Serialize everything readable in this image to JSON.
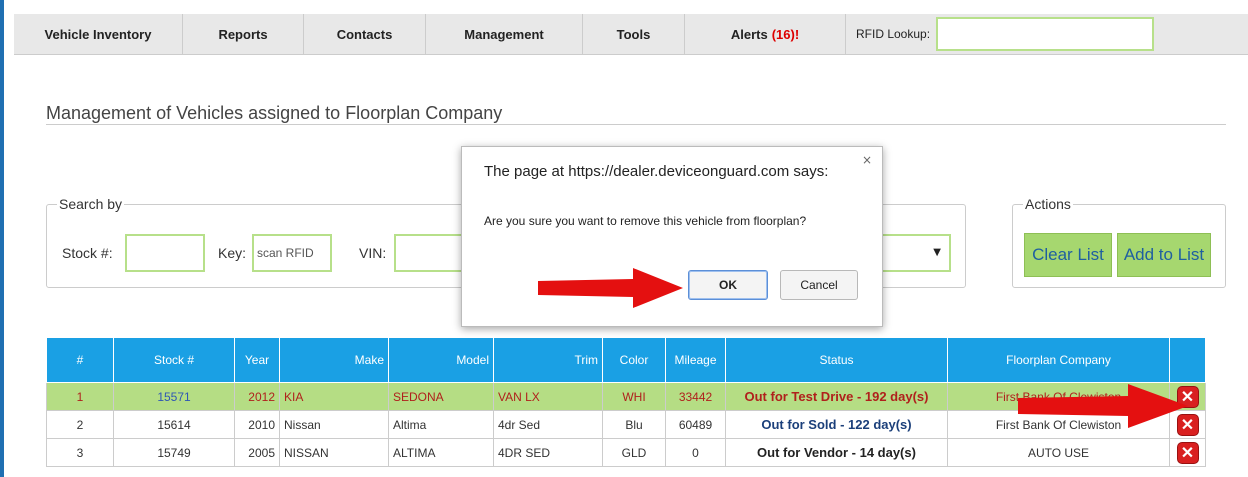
{
  "nav": {
    "items": [
      "Vehicle Inventory",
      "Reports",
      "Contacts",
      "Management",
      "Tools"
    ],
    "alerts_label": "Alerts",
    "alerts_count": "(16)!",
    "rfid_label": "RFID Lookup:",
    "rfid_value": ""
  },
  "page": {
    "title": "Management of Vehicles assigned to Floorplan Company"
  },
  "search": {
    "legend": "Search by",
    "stock_label": "Stock #:",
    "key_label": "Key:",
    "key_value": "scan RFID",
    "vin_label": "VIN:"
  },
  "actions": {
    "legend": "Actions",
    "clear_label": "Clear List",
    "add_label": "Add to List"
  },
  "table": {
    "headers": [
      "#",
      "Stock #",
      "Year",
      "Make",
      "Model",
      "Trim",
      "Color",
      "Mileage",
      "Status",
      "Floorplan Company",
      ""
    ],
    "rows": [
      {
        "num": "1",
        "stock": "15571",
        "year": "2012",
        "make": "KIA",
        "model": "SEDONA",
        "trim": "VAN LX",
        "color": "WHI",
        "mileage": "33442",
        "status": "Out for Test Drive - 192 day(s)",
        "floorplan": "First Bank Of Clewiston"
      },
      {
        "num": "2",
        "stock": "15614",
        "year": "2010",
        "make": "Nissan",
        "model": "Altima",
        "trim": "4dr Sed",
        "color": "Blu",
        "mileage": "60489",
        "status": "Out for Sold - 122 day(s)",
        "floorplan": "First Bank Of Clewiston"
      },
      {
        "num": "3",
        "stock": "15749",
        "year": "2005",
        "make": "NISSAN",
        "model": "ALTIMA",
        "trim": "4DR SED",
        "color": "GLD",
        "mileage": "0",
        "status": "Out for Vendor - 14 day(s)",
        "floorplan": "AUTO USE"
      }
    ]
  },
  "dialog": {
    "title": "The page at https://dealer.deviceonguard.com says:",
    "message": "Are you sure you want to remove this vehicle from floorplan?",
    "ok_label": "OK",
    "cancel_label": "Cancel",
    "close_glyph": "×"
  },
  "icons": {
    "remove": "close-x-icon",
    "arrow": "red-arrow-icon"
  },
  "colors": {
    "header_blue": "#1aa0e4",
    "highlight_green": "#b5dd84",
    "button_green": "#a6d76f",
    "field_border": "#b7e08a",
    "alert_red": "#d00000",
    "remove_red": "#d92020"
  }
}
